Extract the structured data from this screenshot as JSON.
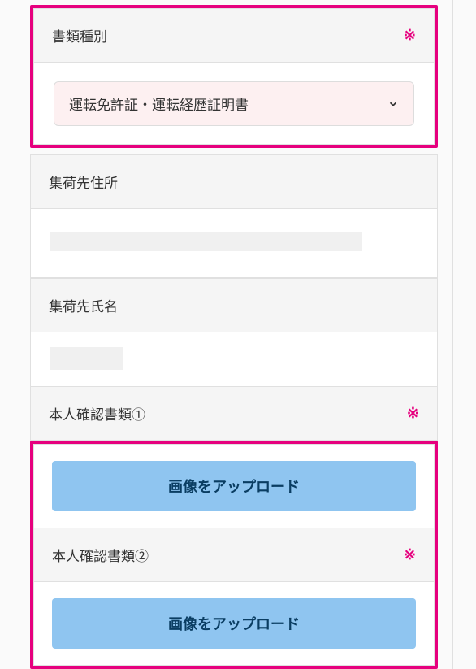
{
  "document_type": {
    "label": "書類種別",
    "required_mark": "※",
    "selected_value": "運転免許証・運転経歴証明書"
  },
  "pickup_address": {
    "label": "集荷先住所"
  },
  "pickup_name": {
    "label": "集荷先氏名"
  },
  "id_doc_1": {
    "label": "本人確認書類①",
    "required_mark": "※",
    "upload_button": "画像をアップロード"
  },
  "id_doc_2": {
    "label": "本人確認書類②",
    "required_mark": "※",
    "upload_button": "画像をアップロード"
  }
}
